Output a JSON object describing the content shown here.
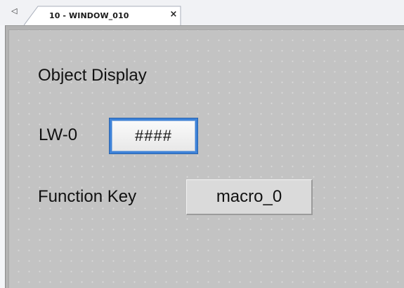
{
  "tabbar": {
    "scroll_left_icon": "triangle-left-icon",
    "tabs": [
      {
        "label": "10 - WINDOW_010",
        "close_icon": "close-icon",
        "close_glyph": "×"
      }
    ]
  },
  "canvas": {
    "background_color": "#c3c3c3",
    "grid_dot_color": "#dadada",
    "objects": {
      "title": "Object Display",
      "lw_label": "LW-0",
      "numeric_display_value": "####",
      "numeric_display_border_color": "#3d82d8",
      "function_key_label": "Function Key",
      "function_key_button": "macro_0"
    }
  }
}
